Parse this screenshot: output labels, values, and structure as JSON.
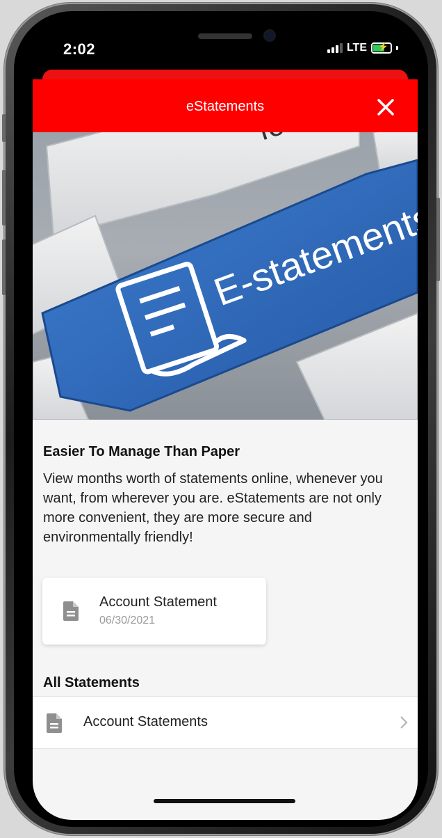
{
  "status_bar": {
    "time": "2:02",
    "network": "LTE"
  },
  "header": {
    "title": "eStatements"
  },
  "hero": {
    "key_text": "E-statements"
  },
  "intro": {
    "headline": "Easier To Manage Than Paper",
    "description": "View months worth of statements online, whenever you want, from wherever you are. eStatements are not only more convenient, they are more secure and environmentally friendly!"
  },
  "recent_statement": {
    "title": "Account Statement",
    "date": "06/30/2021"
  },
  "all_statements": {
    "title": "All Statements",
    "items": [
      {
        "label": "Account Statements"
      }
    ]
  },
  "colors": {
    "brand_red": "#ff0000",
    "battery_green": "#34c759"
  },
  "icons": [
    "close-icon",
    "document-icon",
    "chevron-right-icon",
    "signal-icon",
    "battery-icon"
  ]
}
